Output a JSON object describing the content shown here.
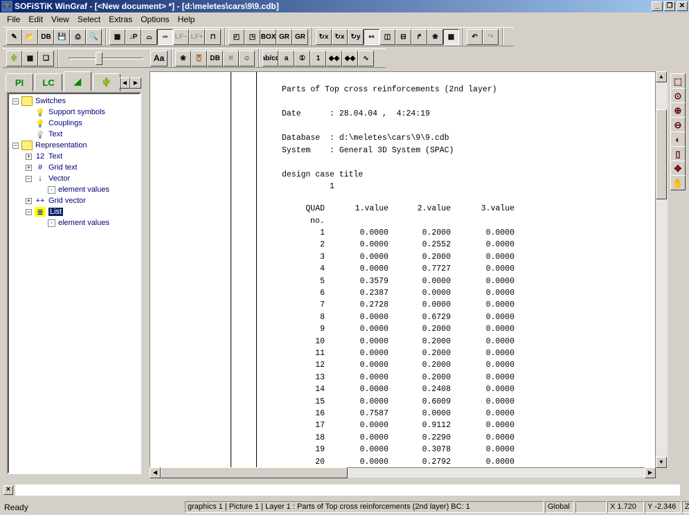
{
  "window": {
    "title": "SOFiSTiK WinGraf - [<New document> *] - [d:\\meletes\\cars\\9\\9.cdb]",
    "min": "_",
    "restore": "❐",
    "close": "✕"
  },
  "menu": [
    "File",
    "Edit",
    "View",
    "Select",
    "Extras",
    "Options",
    "Help"
  ],
  "toolbar1": [
    [
      {
        "icon": "new-doc-icon",
        "g": "✎"
      },
      {
        "icon": "open-folder-icon",
        "g": "📂"
      },
      {
        "icon": "database-icon",
        "g": "DB"
      },
      {
        "icon": "save-icon",
        "g": "💾"
      },
      {
        "icon": "print-icon",
        "g": "⎙"
      },
      {
        "icon": "print-preview-icon",
        "g": "🔍"
      }
    ],
    [
      {
        "icon": "grid-icon",
        "g": "▦"
      },
      {
        "icon": "load-p-icon",
        "g": "↓P"
      },
      {
        "icon": "beam-icon",
        "g": "⌓"
      },
      {
        "icon": "section-icon",
        "g": "═",
        "state": "on"
      },
      {
        "icon": "lf-minus-icon",
        "g": "LF−",
        "state": "dis"
      },
      {
        "icon": "lf-plus-icon",
        "g": "LF+",
        "state": "dis"
      },
      {
        "icon": "section-cut-icon",
        "g": "⊓"
      }
    ],
    [
      {
        "icon": "frame-icon",
        "g": "◰"
      },
      {
        "icon": "frame-shadow-icon",
        "g": "◳"
      },
      {
        "icon": "box-icon",
        "g": "BOX"
      },
      {
        "icon": "gr-157-icon",
        "g": "GR"
      },
      {
        "icon": "gr-all-icon",
        "g": "GR"
      }
    ],
    [
      {
        "icon": "rotate-x-icon",
        "g": "↻x"
      },
      {
        "icon": "rotate-x2-icon",
        "g": "↻x"
      },
      {
        "icon": "rotate-y-icon",
        "g": "↻y"
      },
      {
        "icon": "mirror-icon",
        "g": "⇿",
        "state": "on"
      },
      {
        "icon": "mirror-vertical-icon",
        "g": "◫"
      },
      {
        "icon": "mirror-horizontal-icon",
        "g": "⊟"
      },
      {
        "icon": "rotate-frame-icon",
        "g": "↱"
      },
      {
        "icon": "butterfly-icon",
        "g": "❀"
      },
      {
        "icon": "disabled-pattern-icon",
        "g": "▩",
        "state": "on"
      }
    ],
    [
      {
        "icon": "undo-icon",
        "g": "↶"
      },
      {
        "icon": "redo-icon",
        "g": "↷",
        "state": "dis"
      }
    ]
  ],
  "toolbar2": {
    "left": [
      {
        "icon": "picture-icon",
        "g": "🌵"
      },
      {
        "icon": "picture-grid-icon",
        "g": "▦"
      },
      {
        "icon": "picture-stack-icon",
        "g": "❏"
      }
    ],
    "font_button": "Aa",
    "slider_level": 0.4,
    "mid": [
      {
        "icon": "butterfly-color-icon",
        "g": "❀"
      },
      {
        "icon": "owl-icon",
        "g": "🦉"
      },
      {
        "icon": "db-table-icon",
        "g": "DB"
      },
      {
        "icon": "disabled-shape-icon",
        "g": "✖",
        "state": "dis"
      },
      {
        "icon": "doll-icon",
        "g": "☺"
      }
    ],
    "right": [
      {
        "icon": "abcd-icon",
        "g": "ab/cd"
      },
      {
        "icon": "label-a-icon",
        "g": "a"
      },
      {
        "icon": "magnify-1-icon",
        "g": "①"
      },
      {
        "icon": "label-1-icon",
        "g": "1"
      },
      {
        "icon": "nodes-icon",
        "g": "◆◆"
      },
      {
        "icon": "nodes-grid-icon",
        "g": "◆◆"
      },
      {
        "icon": "polyline-icon",
        "g": "∿"
      }
    ]
  },
  "tabs": [
    {
      "icon": "pi-table-icon",
      "g": "PI"
    },
    {
      "label": "LC"
    },
    {
      "icon": "color-fan-icon",
      "g": "◢"
    },
    {
      "icon": "picture-tab-icon",
      "g": "🌵"
    }
  ],
  "tree": [
    {
      "label": "Switches",
      "level": 0,
      "exp": "−",
      "icon": "folder-icon"
    },
    {
      "label": "Support symbols",
      "level": 1,
      "icon": "bulb-on-icon"
    },
    {
      "label": "Couplings",
      "level": 1,
      "icon": "bulb-on-icon"
    },
    {
      "label": "Text",
      "level": 1,
      "icon": "bulb-off-icon"
    },
    {
      "label": "Representation",
      "level": 0,
      "exp": "−",
      "icon": "folder-icon"
    },
    {
      "label": "Text",
      "level": 1,
      "exp": "+",
      "icon": "text-value-icon"
    },
    {
      "label": "Grid text",
      "level": 1,
      "exp": "+",
      "icon": "grid-text-icon"
    },
    {
      "label": "Vector",
      "level": 1,
      "exp": "−",
      "icon": "vector-icon"
    },
    {
      "label": "element values",
      "level": 2,
      "icon": "element-icon"
    },
    {
      "label": "Grid vector",
      "level": 1,
      "exp": "+",
      "icon": "grid-vector-icon"
    },
    {
      "label": "List",
      "level": 1,
      "exp": "−",
      "icon": "list-doc-icon",
      "selected": true
    },
    {
      "label": "element values",
      "level": 2,
      "icon": "element-icon"
    }
  ],
  "document": {
    "heading": "Parts of Top cross reinforcements (2nd layer)",
    "date_label": "Date",
    "date_value": ": 28.04.04 ,  4:24:19",
    "database_label": "Database",
    "database_value": ": d:\\meletes\\cars\\9\\9.cdb",
    "system_label": "System",
    "system_value": ": General 3D System (SPAC)",
    "design_case_label": "design case title",
    "design_case_value": "1",
    "columns": [
      "QUAD",
      "1.value",
      "2.value",
      "3.value"
    ],
    "subheader": "no.",
    "rows": [
      [
        "1",
        "0.0000",
        "0.2000",
        "0.0000"
      ],
      [
        "2",
        "0.0000",
        "0.2552",
        "0.0000"
      ],
      [
        "3",
        "0.0000",
        "0.2000",
        "0.0000"
      ],
      [
        "4",
        "0.0000",
        "0.7727",
        "0.0000"
      ],
      [
        "5",
        "0.3579",
        "0.0000",
        "0.0000"
      ],
      [
        "6",
        "0.2387",
        "0.0000",
        "0.0000"
      ],
      [
        "7",
        "0.2728",
        "0.0000",
        "0.0000"
      ],
      [
        "8",
        "0.0000",
        "0.6729",
        "0.0000"
      ],
      [
        "9",
        "0.0000",
        "0.2000",
        "0.0000"
      ],
      [
        "10",
        "0.0000",
        "0.2000",
        "0.0000"
      ],
      [
        "11",
        "0.0000",
        "0.2000",
        "0.0000"
      ],
      [
        "12",
        "0.0000",
        "0.2000",
        "0.0000"
      ],
      [
        "13",
        "0.0000",
        "0.2000",
        "0.0000"
      ],
      [
        "14",
        "0.0000",
        "0.2408",
        "0.0000"
      ],
      [
        "15",
        "0.0000",
        "0.6009",
        "0.0000"
      ],
      [
        "16",
        "0.7587",
        "0.0000",
        "0.0000"
      ],
      [
        "17",
        "0.0000",
        "0.9112",
        "0.0000"
      ],
      [
        "18",
        "0.0000",
        "0.2290",
        "0.0000"
      ],
      [
        "19",
        "0.0000",
        "0.3078",
        "0.0000"
      ],
      [
        "20",
        "0.0000",
        "0.2792",
        "0.0000"
      ]
    ]
  },
  "right_tools": [
    {
      "icon": "zoom-window-icon",
      "g": "⬚"
    },
    {
      "icon": "zoom-point-icon",
      "g": "⊙"
    },
    {
      "icon": "zoom-in-icon",
      "g": "⊕"
    },
    {
      "icon": "zoom-out-icon",
      "g": "⊖"
    },
    {
      "icon": "zoom-previous-icon",
      "g": "◐"
    },
    {
      "icon": "zoom-page-icon",
      "g": "▯"
    },
    {
      "icon": "zoom-center-icon",
      "g": "✥"
    },
    {
      "icon": "pan-hand-icon",
      "g": "✋"
    }
  ],
  "command": {
    "close": "×",
    "value": ""
  },
  "status": {
    "ready": "Ready",
    "info": "graphics    1 | Picture    1 | Layer    1 : Parts of Top cross reinforcements (2nd layer)   BC:    1",
    "coord_system": "Global",
    "x": "X 1.720",
    "y": "Y -2.346",
    "z": "Z"
  }
}
